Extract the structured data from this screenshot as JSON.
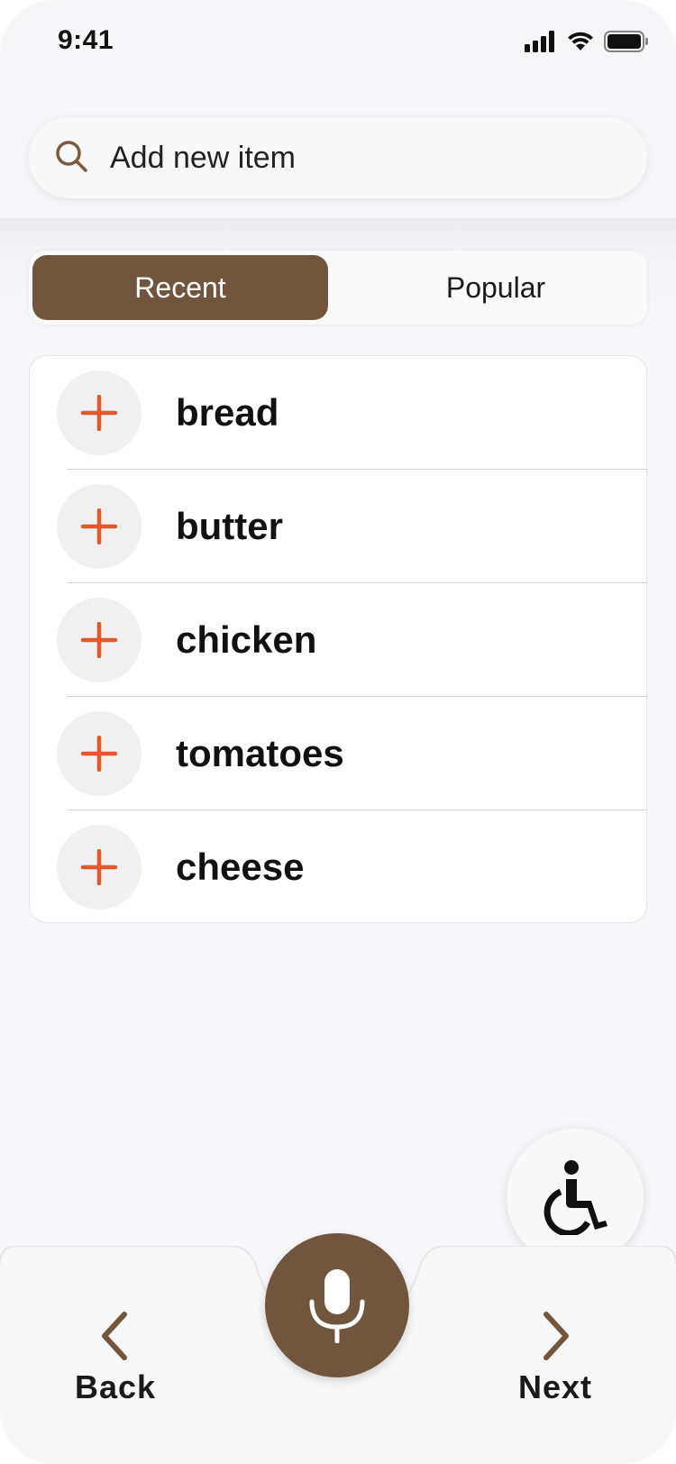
{
  "status_bar": {
    "time": "9:41",
    "icons": [
      "cellular-signal-icon",
      "wifi-icon",
      "battery-icon"
    ]
  },
  "search": {
    "placeholder": "Add new item",
    "icon": "search-icon"
  },
  "tabs": [
    {
      "label": "Recent",
      "active": true
    },
    {
      "label": "Popular",
      "active": false
    }
  ],
  "items": [
    {
      "label": "bread"
    },
    {
      "label": "butter"
    },
    {
      "label": "chicken"
    },
    {
      "label": "tomatoes"
    },
    {
      "label": "cheese"
    }
  ],
  "bottom_nav": {
    "back_label": "Back",
    "next_label": "Next",
    "mic_icon": "microphone-icon"
  },
  "accessibility_icon": "wheelchair-icon",
  "colors": {
    "accent": "#72553d",
    "plus": "#e2572b",
    "background": "#f7f7f9"
  }
}
